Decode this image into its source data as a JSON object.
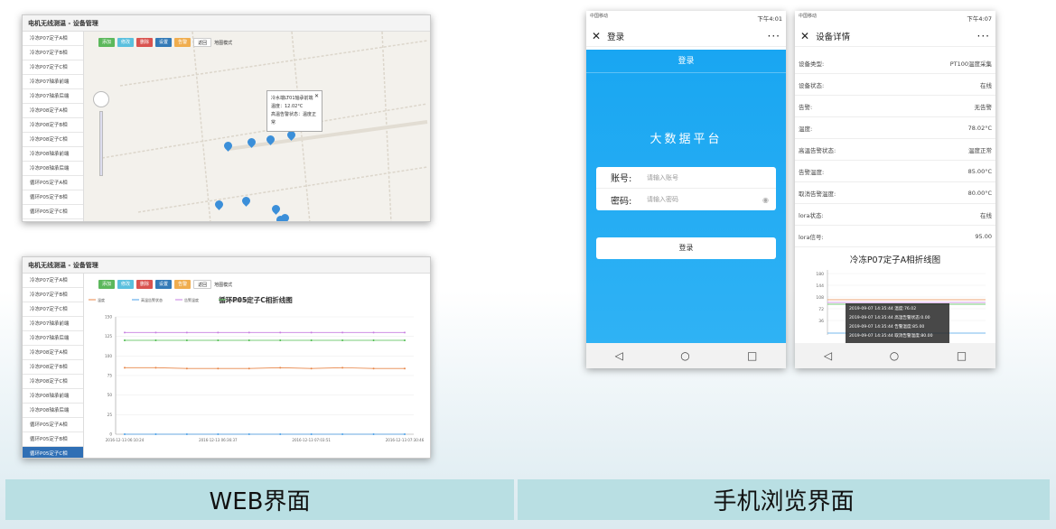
{
  "web_map": {
    "title": "电机无线测温 - 设备管理",
    "sidebar": [
      "冷冻P07定子A相",
      "冷冻P07定子B相",
      "冷冻P07定子C相",
      "冷冻P07轴承前端",
      "冷冻P07轴承后端",
      "冷冻P08定子A相",
      "冷冻P08定子B相",
      "冷冻P08定子C相",
      "冷冻P08轴承前端",
      "冷冻P08轴承后端",
      "循环P05定子A相",
      "循环P05定子B相",
      "循环P05定子C相"
    ],
    "buttons": [
      "添加",
      "修改",
      "删除",
      "设置",
      "告警",
      "返回"
    ],
    "map_mode": "地图模式",
    "popup": {
      "title": "冷水端LT01轴承前端",
      "line1": "温度：12.02°C",
      "line2": "高温告警状态：温度正常"
    }
  },
  "web_chart": {
    "title": "电机无线测温 - 设备管理",
    "sidebar": [
      "冷冻P07定子A相",
      "冷冻P07定子B相",
      "冷冻P07定子C相",
      "冷冻P07轴承前端",
      "冷冻P07轴承后端",
      "冷冻P08定子A相",
      "冷冻P08定子B相",
      "冷冻P08定子C相",
      "冷冻P08轴承前端",
      "冷冻P08轴承后端",
      "循环P05定子A相",
      "循环P05定子B相",
      "循环P05定子C相",
      "循环P05轴承前端",
      "循环P05轴承后端"
    ],
    "active_index": 12,
    "buttons": [
      "添加",
      "修改",
      "删除",
      "设置",
      "告警",
      "返回"
    ],
    "map_mode": "地图模式",
    "legend": [
      "温度",
      "高温告警状态",
      "告警温度",
      "取消告警温度"
    ]
  },
  "chart_data": {
    "type": "line",
    "title": "循环P05定子C相折线图",
    "x": [
      "2016-12-13 06:10:24",
      "2016-12-13 06:36:37",
      "2016-12-13 07:03:51",
      "2016-12-13 07:30:46"
    ],
    "yticks": [
      "150",
      "125",
      "100",
      "75",
      "50",
      "25",
      "0"
    ],
    "ylim": [
      0,
      150
    ],
    "series": [
      {
        "name": "温度",
        "color": "#e8874a",
        "values": [
          85,
          85,
          84,
          84,
          84,
          85,
          84,
          85,
          84,
          84
        ]
      },
      {
        "name": "高温告警状态",
        "color": "#4aa0e8",
        "values": [
          0,
          0,
          0,
          0,
          0,
          0,
          0,
          0,
          0,
          0
        ]
      },
      {
        "name": "告警温度",
        "color": "#c77ee0",
        "values": [
          130,
          130,
          130,
          130,
          130,
          130,
          130,
          130,
          130,
          130
        ]
      },
      {
        "name": "取消告警温度",
        "color": "#4bbb4b",
        "values": [
          120,
          120,
          120,
          120,
          120,
          120,
          120,
          120,
          120,
          120
        ]
      }
    ]
  },
  "phone_login": {
    "carrier": "中国移动",
    "time": "下午4:01",
    "nav_title": "登录",
    "header": "登录",
    "platform": "大数据平台",
    "account_label": "账号:",
    "account_placeholder": "请输入账号",
    "password_label": "密码:",
    "password_placeholder": "请输入密码",
    "login_button": "登录"
  },
  "phone_detail": {
    "carrier": "中国移动",
    "time": "下午4:07",
    "nav_title": "设备详情",
    "rows": [
      {
        "k": "设备类型:",
        "v": "PT100温度采集"
      },
      {
        "k": "设备状态:",
        "v": "在线"
      },
      {
        "k": "告警:",
        "v": "无告警"
      },
      {
        "k": "温度:",
        "v": "78.02°C"
      },
      {
        "k": "高温告警状态:",
        "v": "温度正常"
      },
      {
        "k": "告警温度:",
        "v": "85.00°C"
      },
      {
        "k": "取消告警温度:",
        "v": "80.00°C"
      },
      {
        "k": "lora状态:",
        "v": "在线"
      },
      {
        "k": "lora信号:",
        "v": "95.00"
      }
    ],
    "chart_title": "冷冻P07定子A相折线图",
    "yticks": [
      "180",
      "144",
      "108",
      "72",
      "36"
    ],
    "tooltip": [
      "2019-09-07 14:35:44 温度:76.02",
      "2019-09-07 14:35:44 高温告警状态:0.00",
      "2019-09-07 14:35:44 告警温度:85.00",
      "2019-09-07 14:35:44 取消告警温度:80.00"
    ]
  },
  "captions": {
    "left": "WEB界面",
    "right": "手机浏览界面"
  },
  "colors": {
    "brand_blue": "#1aa3ef",
    "caption_bg": "#b9dfe3",
    "active": "#2f6fb5"
  }
}
